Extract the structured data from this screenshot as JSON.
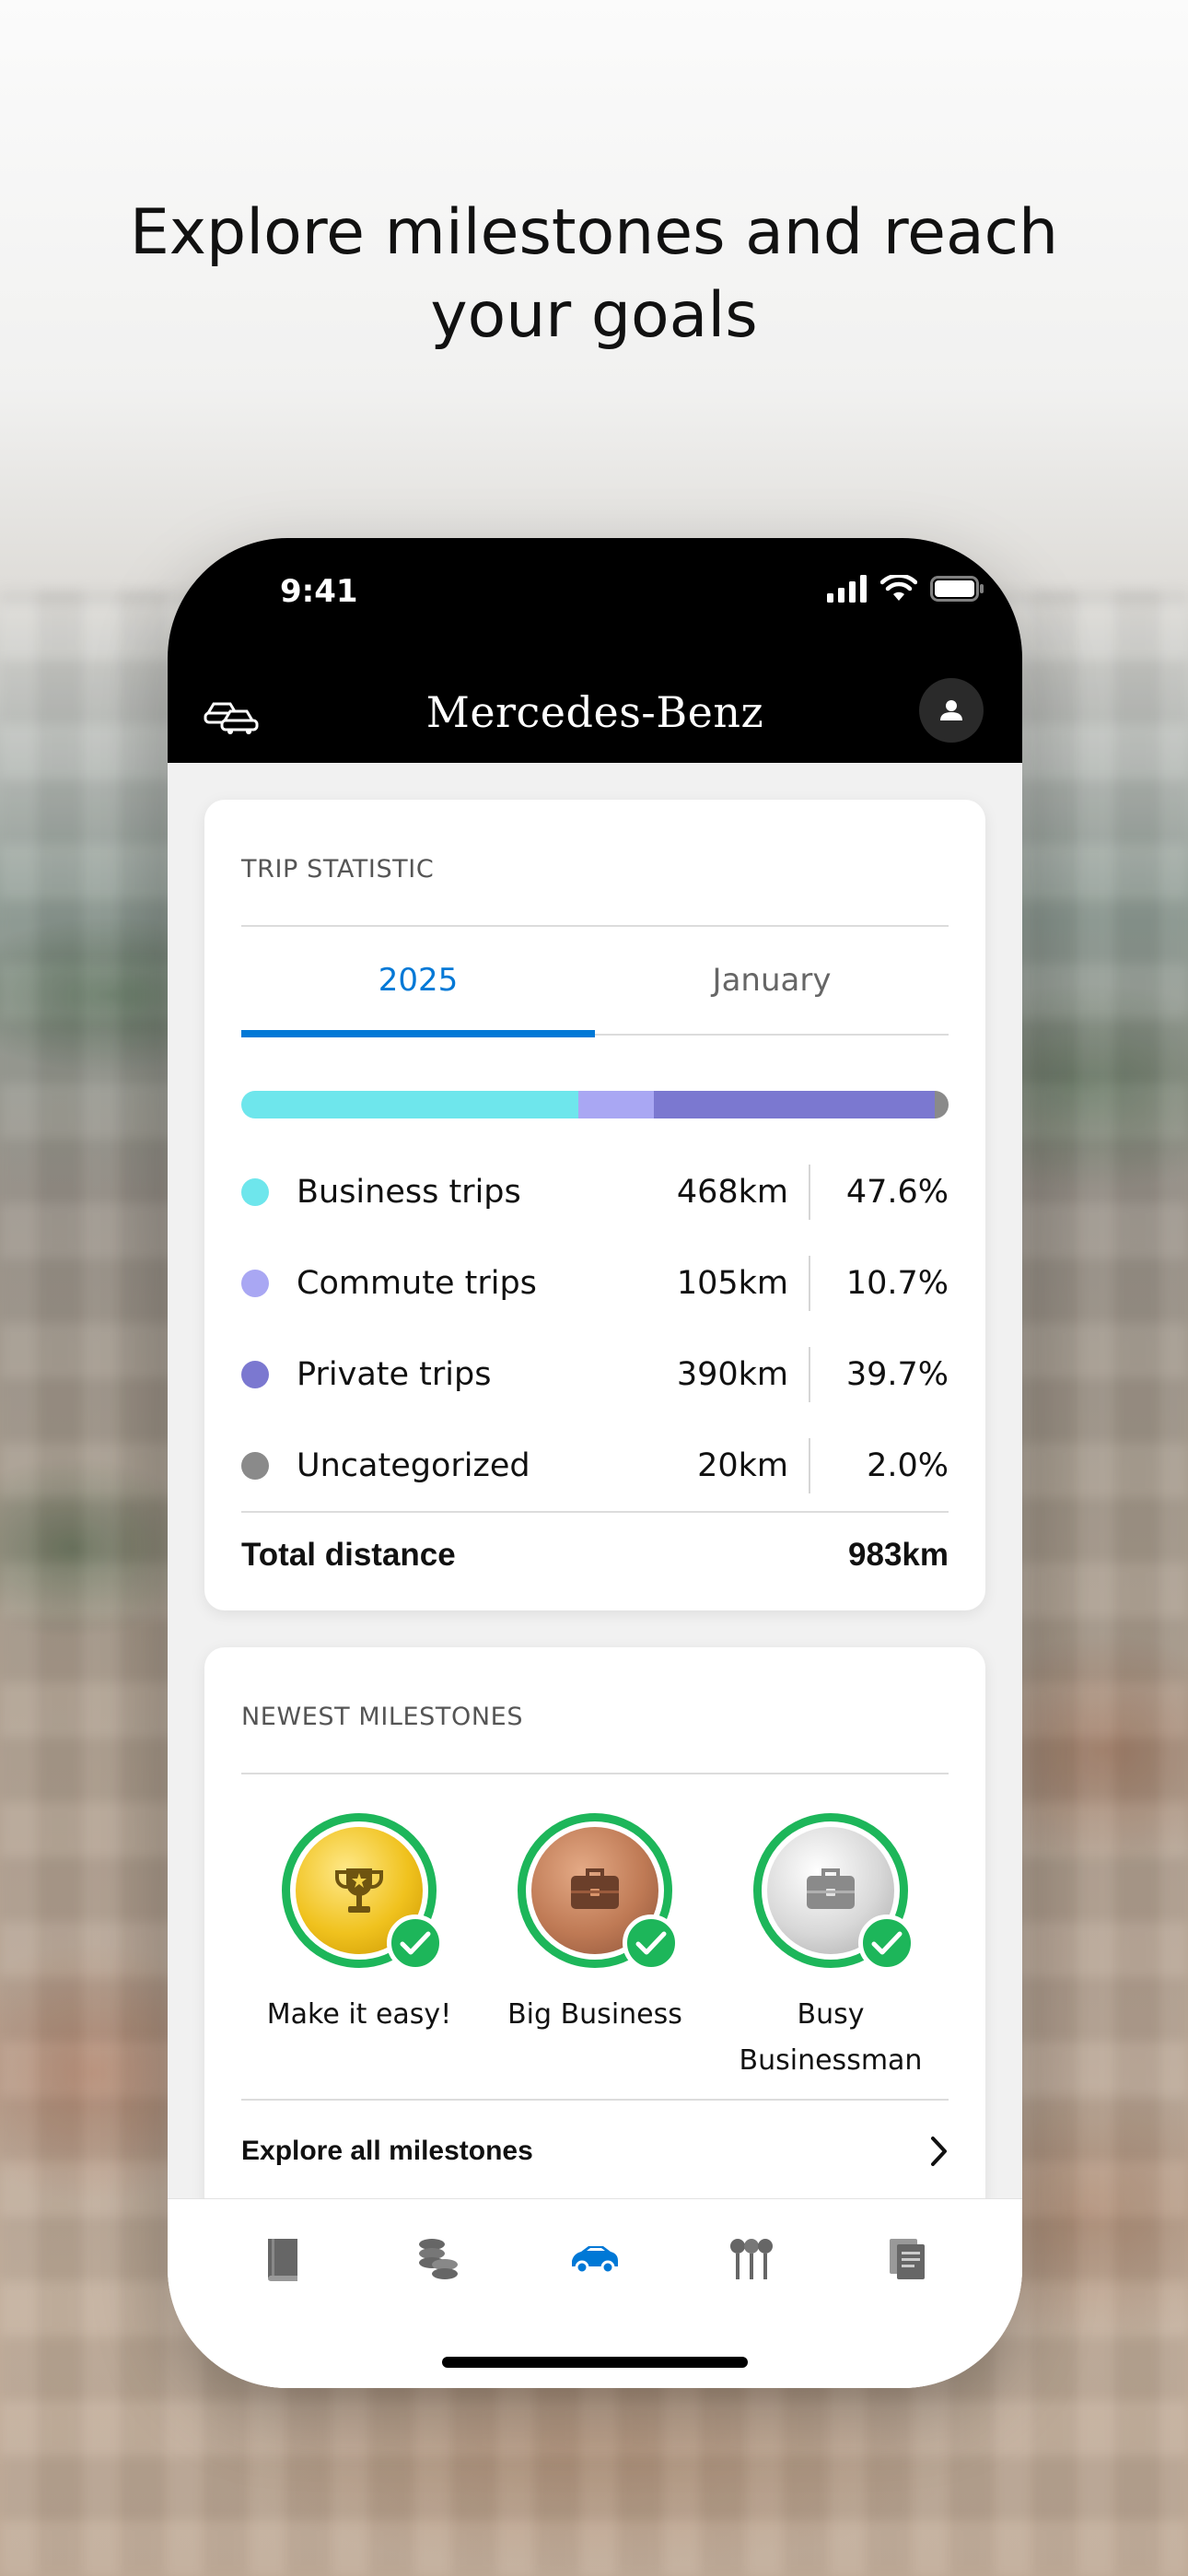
{
  "headline": {
    "line1": "Explore milestones and reach",
    "line2": "your goals"
  },
  "status_bar": {
    "time": "9:41"
  },
  "app_bar": {
    "brand": "Mercedes-Benz"
  },
  "trip_statistic": {
    "title": "TRIP STATISTIC",
    "tabs": [
      {
        "label": "2025",
        "active": true
      },
      {
        "label": "January",
        "active": false
      }
    ],
    "rows": [
      {
        "label": "Business trips",
        "km": "468km",
        "pct": "47.6%",
        "share": 0.476,
        "color": "#6ee6ec"
      },
      {
        "label": "Commute trips",
        "km": "105km",
        "pct": "10.7%",
        "share": 0.107,
        "color": "#a9a7f3"
      },
      {
        "label": "Private trips",
        "km": "390km",
        "pct": "39.7%",
        "share": 0.397,
        "color": "#7b78d0"
      },
      {
        "label": "Uncategorized",
        "km": "20km",
        "pct": "2.0%",
        "share": 0.02,
        "color": "#8a8a8a"
      }
    ],
    "total_label": "Total distance",
    "total_value": "983km"
  },
  "milestones": {
    "title": "NEWEST MILESTONES",
    "items": [
      {
        "label": "Make it easy!",
        "medal": "gold",
        "icon": "trophy-icon"
      },
      {
        "label": "Big Business",
        "medal": "bronze",
        "icon": "briefcase-icon"
      },
      {
        "label": "Busy\nBusinessman",
        "medal": "silver",
        "icon": "briefcase-icon"
      }
    ],
    "explore_label": "Explore all milestones"
  },
  "bottom_nav": {
    "items": [
      {
        "icon": "book-icon",
        "active": false
      },
      {
        "icon": "coins-icon",
        "active": false
      },
      {
        "icon": "car-icon",
        "active": true
      },
      {
        "icon": "charging-icon",
        "active": false
      },
      {
        "icon": "documents-icon",
        "active": false
      }
    ],
    "active_color": "#0078d6"
  }
}
